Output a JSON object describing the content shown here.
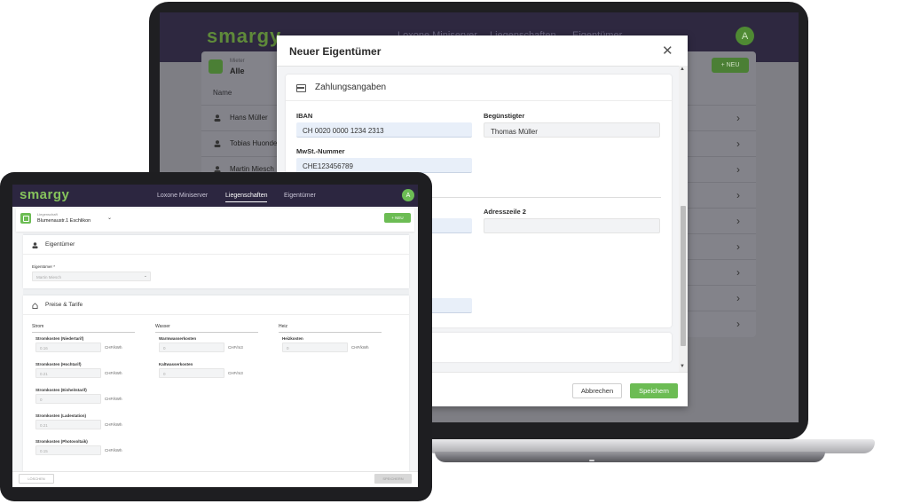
{
  "laptop": {
    "logo": "smargy",
    "nav": [
      "Loxone Miniserver",
      "Liegenschaften",
      "Eigentümer"
    ],
    "avatar": "A",
    "filter_label": "Mieter",
    "filter_value": "Alle",
    "new_button": "+ NEU",
    "column_name": "Name",
    "rows": [
      "Hans Müller",
      "Tobias Huonder",
      "Martin Miesch",
      "",
      "",
      "",
      "",
      "",
      ""
    ]
  },
  "modal": {
    "title": "Neuer Eigentümer",
    "close": "✕",
    "section_title": "Zahlungsangaben",
    "iban_label": "IBAN",
    "iban_value": "CH 0020 0000 1234 2313",
    "beneficiary_label": "Begünstigter",
    "beneficiary_value": "Thomas Müller",
    "vat_label": "MwSt.-Nummer",
    "vat_value": "CHE123456789",
    "address2_label": "Adresszeile 2",
    "cancel": "Abbrechen",
    "save": "Speichern"
  },
  "tablet": {
    "logo": "smargy",
    "nav": [
      "Loxone Miniserver",
      "Liegenschaften",
      "Eigentümer"
    ],
    "active_nav": "Liegenschaften",
    "avatar": "A",
    "property_label": "Liegenschaft",
    "property_value": "Blumenaustr.1 Eschlikon",
    "new_button": "+ NEU",
    "owner_section": "Eigentümer",
    "owner_field_label": "Eigentümer *",
    "owner_field_value": "Martin Miesch",
    "prices_section": "Preise & Tarife",
    "col_strom": "Strom",
    "col_wasser": "Wasser",
    "col_heiz": "Heiz",
    "strom": [
      {
        "label": "Stromkosten (Niedertarif)",
        "value": "0.16",
        "unit": "CHF/kWh"
      },
      {
        "label": "Stromkosten (Hochtarif)",
        "value": "0.21",
        "unit": "CHF/kWh"
      },
      {
        "label": "Stromkosten (Einheitstarif)",
        "value": "0",
        "unit": "CHF/kWh"
      },
      {
        "label": "Stromkosten (Ladestation)",
        "value": "0.21",
        "unit": "CHF/kWh"
      },
      {
        "label": "Stromkosten (Photovoltaik)",
        "value": "0.15",
        "unit": "CHF/kWh"
      }
    ],
    "wasser": [
      {
        "label": "Warmwasserkosten",
        "value": "0",
        "unit": "CHF/m3"
      },
      {
        "label": "Kaltwasserkosten",
        "value": "0",
        "unit": "CHF/m3"
      }
    ],
    "heiz": [
      {
        "label": "Heizkosten",
        "value": "0",
        "unit": "CHF/kWh"
      }
    ],
    "delete_button": "LÖSCHEN",
    "save_button": "SPEICHERN"
  }
}
